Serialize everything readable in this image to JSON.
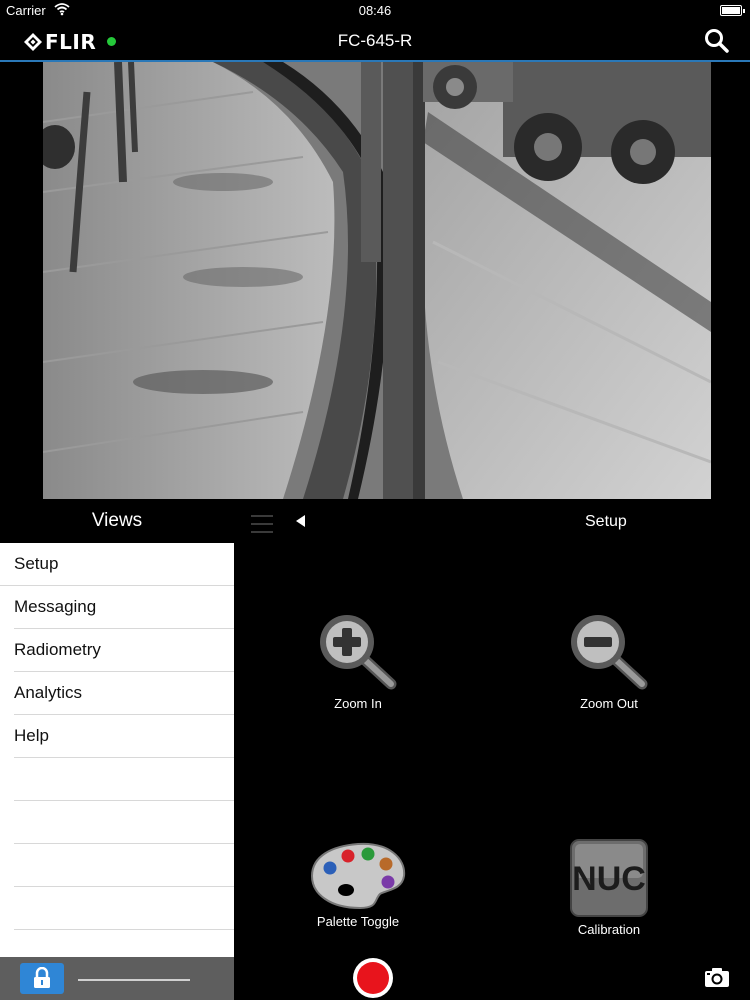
{
  "status_bar": {
    "carrier": "Carrier",
    "time": "08:46"
  },
  "nav": {
    "brand": "FLIR",
    "device": "FC-645-R",
    "connection_color": "#25c93a"
  },
  "views": {
    "title": "Views",
    "items": [
      "Setup",
      "Messaging",
      "Radiometry",
      "Analytics",
      "Help"
    ]
  },
  "panel": {
    "title": "Setup",
    "actions": {
      "zoom_in": "Zoom In",
      "zoom_out": "Zoom Out",
      "palette": "Palette Toggle",
      "calibration": "Calibration",
      "nuc_text": "NUC"
    }
  },
  "colors": {
    "accent": "#2a78b8",
    "lock": "#2f86d6",
    "record": "#e8141c"
  }
}
